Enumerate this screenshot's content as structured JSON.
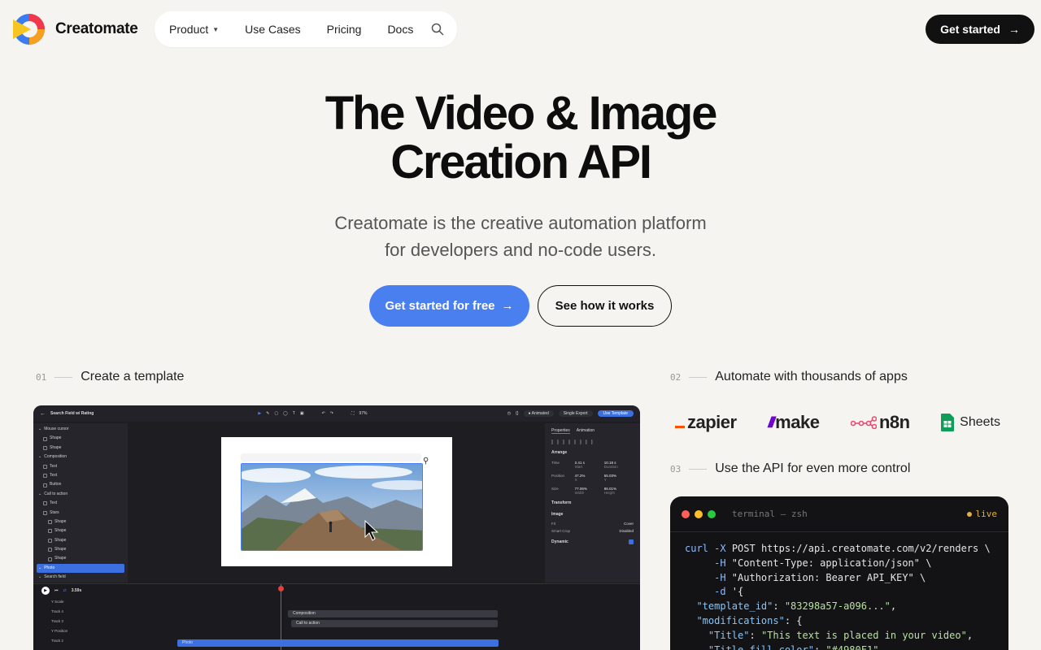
{
  "brand": {
    "name": "Creatomate"
  },
  "nav": {
    "items": [
      {
        "label": "Product",
        "has_menu": true
      },
      {
        "label": "Use Cases",
        "has_menu": false
      },
      {
        "label": "Pricing",
        "has_menu": false
      },
      {
        "label": "Docs",
        "has_menu": false
      }
    ],
    "search_icon": "search-icon",
    "cta_label": "Get started",
    "cta_icon": "arrow-right-icon"
  },
  "hero": {
    "title_line1": "The Video & Image",
    "title_line2": "Creation API",
    "subtitle_line1": "Creatomate is the creative automation platform",
    "subtitle_line2": "for developers and no-code users.",
    "primary_button": "Get started for free",
    "secondary_button": "See how it works",
    "primary_color": "#4a7ff0"
  },
  "steps": [
    {
      "num": "01",
      "label": "Create a template"
    },
    {
      "num": "02",
      "label": "Automate with thousands of apps"
    },
    {
      "num": "03",
      "label": "Use the API for even more control"
    }
  ],
  "editor": {
    "template_name": "Search Field w/ Rating",
    "zoom": "97%",
    "animated_label": "Animated",
    "export_label": "Single Export",
    "use_template_label": "Use Template",
    "layers": [
      {
        "label": "Mouse cursor",
        "indent": 0
      },
      {
        "label": "Shape",
        "indent": 1
      },
      {
        "label": "Shape",
        "indent": 1
      },
      {
        "label": "Composition",
        "indent": 0
      },
      {
        "label": "Text",
        "indent": 1
      },
      {
        "label": "Text",
        "indent": 1
      },
      {
        "label": "Button",
        "indent": 1
      },
      {
        "label": "Call to action",
        "indent": 0
      },
      {
        "label": "Text",
        "indent": 1
      },
      {
        "label": "Stars",
        "indent": 1
      },
      {
        "label": "Shape",
        "indent": 2
      },
      {
        "label": "Shape",
        "indent": 2
      },
      {
        "label": "Shape",
        "indent": 2
      },
      {
        "label": "Shape",
        "indent": 2
      },
      {
        "label": "Shape",
        "indent": 2
      },
      {
        "label": "Photo",
        "indent": 0,
        "selected": true
      },
      {
        "label": "Search field",
        "indent": 0
      }
    ],
    "panel_tabs": [
      "Properties",
      "Animation"
    ],
    "panel_sections": [
      "Arrange",
      "Transform",
      "Image",
      "Dynamic"
    ],
    "props": [
      {
        "label": "Time",
        "a": "2.41 s",
        "a_sub": "Start",
        "b": "10.18 s",
        "b_sub": "Duration"
      },
      {
        "label": "Position",
        "a": "47.2%",
        "a_sub": "X",
        "b": "55.03%",
        "b_sub": "Y"
      },
      {
        "label": "Size",
        "a": "77.06%",
        "a_sub": "Width",
        "b": "86.01%",
        "b_sub": "Height"
      }
    ],
    "image_fit_label": "Fit",
    "image_fit_value": "Cover",
    "smart_crop_label": "Smart Crop",
    "smart_crop_value": "Disabled",
    "playhead_time": "3.59s",
    "tracks": [
      {
        "label": "Y Scale"
      },
      {
        "label": "Track 4"
      },
      {
        "label": "Track 3"
      },
      {
        "label": "Y Position"
      },
      {
        "label": "Track 2"
      }
    ],
    "track_bars": [
      "Composition",
      "Call to action",
      "Photo"
    ]
  },
  "integrations": [
    {
      "name": "zapier",
      "icon": "zapier-logo",
      "color": "#ff4f00"
    },
    {
      "name": "make",
      "icon": "make-logo",
      "color": "#6d00cc"
    },
    {
      "name": "n8n",
      "icon": "n8n-logo",
      "color": "#ea4b71"
    },
    {
      "name": "Sheets",
      "icon": "google-sheets-logo",
      "color": "#0f9d58"
    }
  ],
  "terminal": {
    "title": "terminal — zsh",
    "status": "live",
    "lines": [
      "curl -X POST https://api.creatomate.com/v2/renders \\",
      "     -H \"Content-Type: application/json\" \\",
      "     -H \"Authorization: Bearer API_KEY\" \\",
      "     -d '{",
      "  \"template_id\": \"83298a57-a096...\",",
      "  \"modifications\": {",
      "    \"Title\": \"This text is placed in your video\",",
      "    \"Title.fill_color\": \"#4980F1\""
    ]
  }
}
